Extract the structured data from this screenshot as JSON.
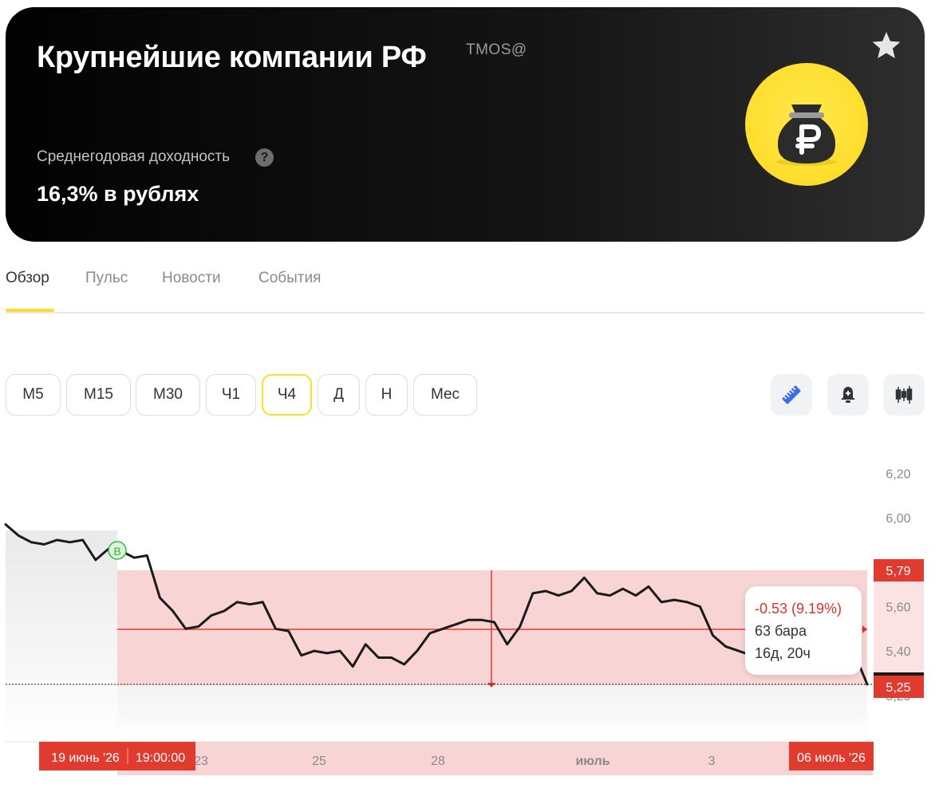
{
  "hero": {
    "title": "Крупнейшие компании РФ",
    "ticker": "TMOS@",
    "yield_label": "Среднегодовая доходность",
    "yield_help": "?",
    "yield_value": "16,3% в рублях",
    "icons": {
      "favorite": "star-icon",
      "fund": "money-bag-ruble-icon"
    },
    "colors": {
      "accent": "#ffdd2d",
      "background": "#0a0a0a"
    }
  },
  "tabs": [
    "Обзор",
    "Пульс",
    "Новости",
    "События"
  ],
  "active_tab": "Обзор",
  "timeframes": [
    "M5",
    "M15",
    "M30",
    "Ч1",
    "Ч4",
    "Д",
    "Н",
    "Мес"
  ],
  "active_timeframe": "Ч4",
  "tools": [
    "ruler-icon",
    "add-alert-bell-icon",
    "candles-icon"
  ],
  "tooltip": {
    "change": "-0.53 (9.19%)",
    "bars": "63 бара",
    "duration": "16д, 20ч"
  },
  "chart_data": {
    "type": "line",
    "ticker": "TMOS@",
    "timeframe": "Ч4",
    "x_ticks": [
      "23",
      "25",
      "28",
      "июль",
      "3"
    ],
    "y_ticks": [
      "6,20",
      "6,00",
      "5,60",
      "5,40",
      "5,20"
    ],
    "ylim": [
      5.07,
      6.27
    ],
    "price_labels": {
      "range_high": "5,79",
      "last": "5,25"
    },
    "range_start_label": "19 июнь '26",
    "range_start_time": "19:00:00",
    "range_end_label": "06 июль '26",
    "marker": {
      "label": "B",
      "color": "#3fae4b"
    },
    "colors": {
      "line": "#1a1a1a",
      "range_fill": "#f8d4d4",
      "range_accent": "#e13b2f"
    },
    "series": [
      {
        "values": [
          5.97,
          5.92,
          5.89,
          5.88,
          5.9,
          5.89,
          5.9,
          5.81,
          5.86,
          5.85,
          5.82,
          5.83,
          5.64,
          5.58,
          5.5,
          5.51,
          5.56,
          5.58,
          5.62,
          5.61,
          5.62,
          5.5,
          5.49,
          5.38,
          5.4,
          5.39,
          5.4,
          5.33,
          5.43,
          5.37,
          5.37,
          5.34,
          5.4,
          5.48,
          5.5,
          5.52,
          5.54,
          5.54,
          5.53,
          5.43,
          5.51,
          5.66,
          5.67,
          5.65,
          5.67,
          5.73,
          5.66,
          5.65,
          5.68,
          5.65,
          5.69,
          5.62,
          5.63,
          5.62,
          5.6,
          5.47,
          5.42,
          5.4,
          5.38,
          5.32,
          5.4,
          5.38,
          5.37,
          5.39,
          5.36,
          5.4,
          5.39,
          5.25
        ]
      }
    ]
  }
}
